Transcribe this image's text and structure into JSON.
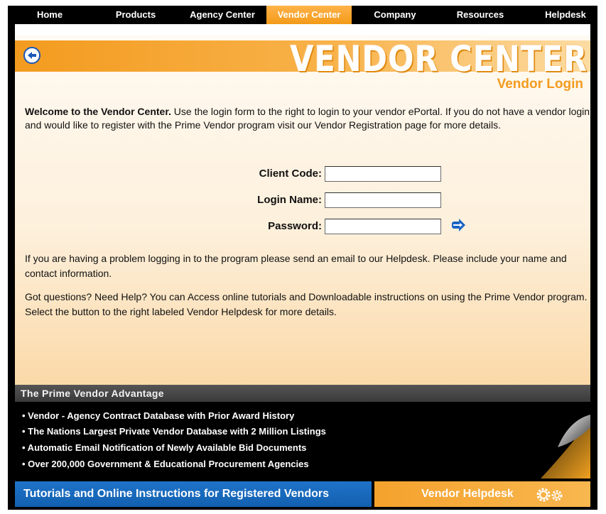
{
  "nav": {
    "items": [
      "Home",
      "Products",
      "Agency Center",
      "Vendor Center",
      "Company",
      "Resources",
      "Helpdesk"
    ],
    "active": "Vendor Center"
  },
  "banner": {
    "title": "VENDOR CENTER",
    "subtitle": "Vendor Login"
  },
  "intro": {
    "bold": "Welcome to the Vendor Center.",
    "text": " Use the login form to the right to login to your vendor ePortal. If you do not have a vendor login and would like to register with the Prime Vendor program visit our Vendor Registration page for more details."
  },
  "form": {
    "client_code_label": "Client Code:",
    "client_code_value": "",
    "login_name_label": "Login Name:",
    "login_name_value": "",
    "password_label": "Password:",
    "password_value": ""
  },
  "help": {
    "problem": "If you are having a problem logging in to the program please send an email to our Helpdesk. Please include your name and contact information.",
    "questions": "Got questions? Need Help? You can Access online tutorials and Downloadable instructions on using the Prime Vendor program. Select the button to the right labeled Vendor Helpdesk for more details."
  },
  "advantage": {
    "title": "The Prime Vendor Advantage",
    "items": [
      "• Vendor - Agency Contract Database with Prior Award History",
      "• The Nations Largest Private Vendor Database with 2 Million Listings",
      "• Automatic Email Notification of Newly Available Bid Documents",
      "• Over 200,000 Government & Educational Procurement Agencies"
    ]
  },
  "bottom": {
    "tutorials_label": "Tutorials and Online Instructions for Registered Vendors",
    "helpdesk_label": "Vendor Helpdesk"
  },
  "colors": {
    "accent_orange": "#f39b1f",
    "nav_bg": "#000000",
    "tutorial_blue": "#1a6bc0"
  }
}
